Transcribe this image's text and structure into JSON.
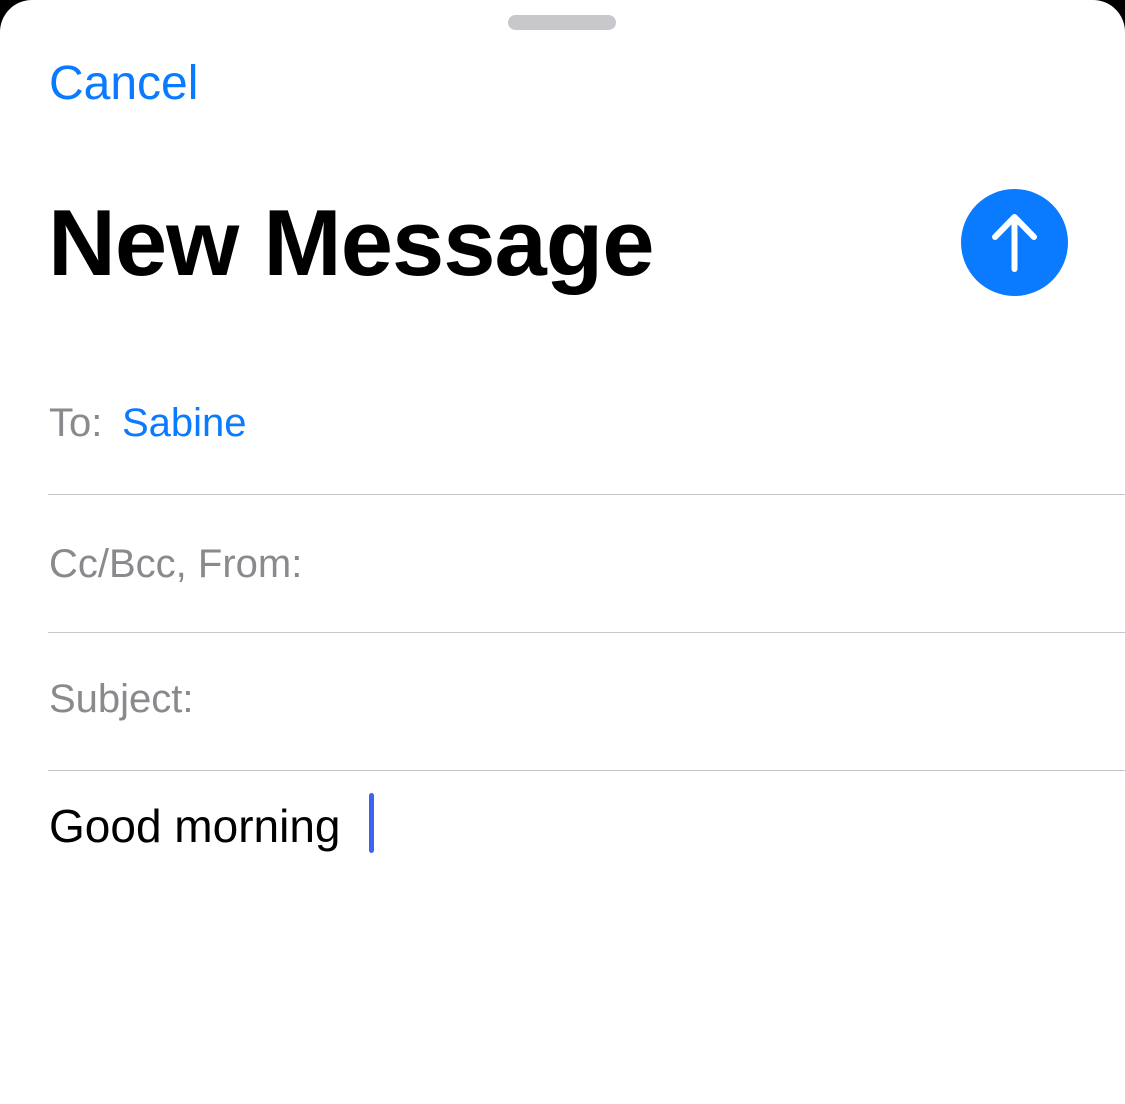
{
  "compose": {
    "cancel_label": "Cancel",
    "title": "New Message",
    "send_icon": "arrow-up-icon",
    "accent_color": "#0a7aff"
  },
  "fields": {
    "to_label": "To:",
    "to_recipient": "Sabine",
    "cc_bcc_from_label": "Cc/Bcc, From:",
    "subject_label": "Subject:",
    "subject_value": ""
  },
  "body": {
    "text": "Good morning"
  }
}
